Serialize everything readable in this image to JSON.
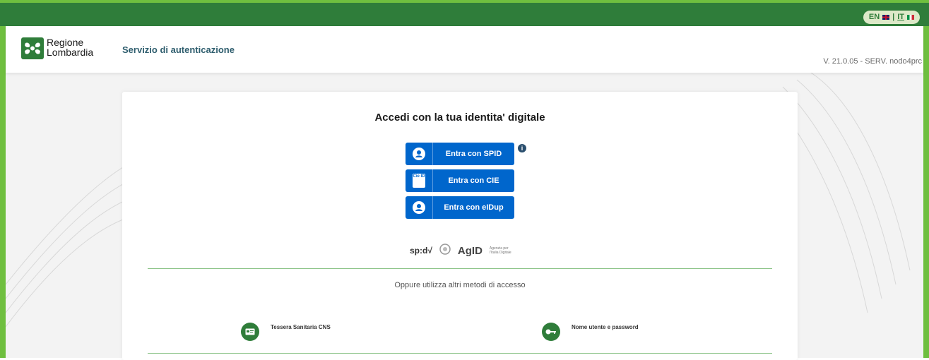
{
  "top_bar": {
    "lang_en": "EN",
    "lang_sep": "|",
    "lang_it": "IT",
    "colors": {
      "bar": "#2f7d3a",
      "frame": "#6fbf3f",
      "pill": "#dde9c8"
    }
  },
  "header": {
    "logo_line1": "Regione",
    "logo_line2": "Lombardia",
    "service_title": "Servizio di autenticazione",
    "version": "V. 21.0.05 - SERV. nodo4prc"
  },
  "login": {
    "title": "Accedi con la tua identita' digitale",
    "buttons": [
      {
        "label": "Entra con SPID",
        "icon": "user-icon"
      },
      {
        "label": "Entra con CIE",
        "icon": "cie-id-card-icon",
        "icon_text": "Cie ID"
      },
      {
        "label": "Entra con eIDup",
        "icon": "user-icon"
      }
    ],
    "info_icon_text": "i",
    "button_color": "#0066cc",
    "logos": {
      "spid": "sp:d√",
      "agid": "AgID",
      "agid_sub": "Agenzia per l'Italia Digitale"
    },
    "alt_methods_text": "Oppure utilizza altri metodi di accesso",
    "methods": [
      {
        "label": "Tessera Sanitaria CNS",
        "icon": "health-card-icon"
      },
      {
        "label": "Nome utente e password",
        "icon": "key-icon"
      }
    ]
  }
}
